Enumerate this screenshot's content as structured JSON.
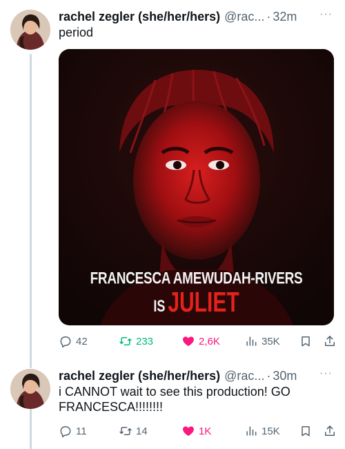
{
  "tweets": [
    {
      "name": "rachel zegler (she/her/hers)",
      "handle": "@rac...",
      "separator": "·",
      "time": "32m",
      "more": "···",
      "text": "period",
      "media": {
        "line1": "FRANCESCA AMEWUDAH-RIVERS",
        "is_word": "IS",
        "highlight": "JULIET",
        "accent_color": "#e3221b"
      },
      "stats": {
        "replies": "42",
        "retweets": "233",
        "likes": "2,6K",
        "views": "35K"
      }
    },
    {
      "name": "rachel zegler (she/her/hers)",
      "handle": "@rac...",
      "separator": "·",
      "time": "30m",
      "more": "···",
      "text": "i CANNOT wait to see this production! GO FRANCESCA!!!!!!!!",
      "stats": {
        "replies": "11",
        "retweets": "14",
        "likes": "1K",
        "views": "15K"
      }
    }
  ],
  "colors": {
    "retweet": "#00ba7c",
    "like": "#f91880",
    "muted": "#536471"
  },
  "icons": [
    "reply-icon",
    "retweet-icon",
    "heart-icon",
    "views-icon",
    "bookmark-icon",
    "share-icon",
    "more-icon"
  ]
}
